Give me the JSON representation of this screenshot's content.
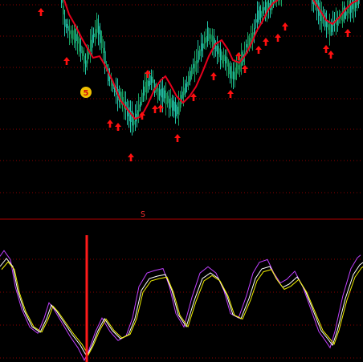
{
  "panel_separator_label": "S",
  "signal_badge_label": "5",
  "colors": {
    "background": "#000000",
    "gridline": "#8b0000",
    "separator": "#b00000",
    "candle_up": "#22c7a9",
    "candle_down": "#18a060",
    "moving_average": "#e8001c",
    "buy_arrow": "#ff1010",
    "signal_badge": "#f0c000",
    "oscillator_fast": "#c040ff",
    "oscillator_mid": "#ffffff",
    "oscillator_slow": "#f0f000",
    "marker_line": "#ff1a1a"
  },
  "icons": {
    "buy": "up-arrow-icon",
    "signal": "smiley-badge-icon"
  }
}
